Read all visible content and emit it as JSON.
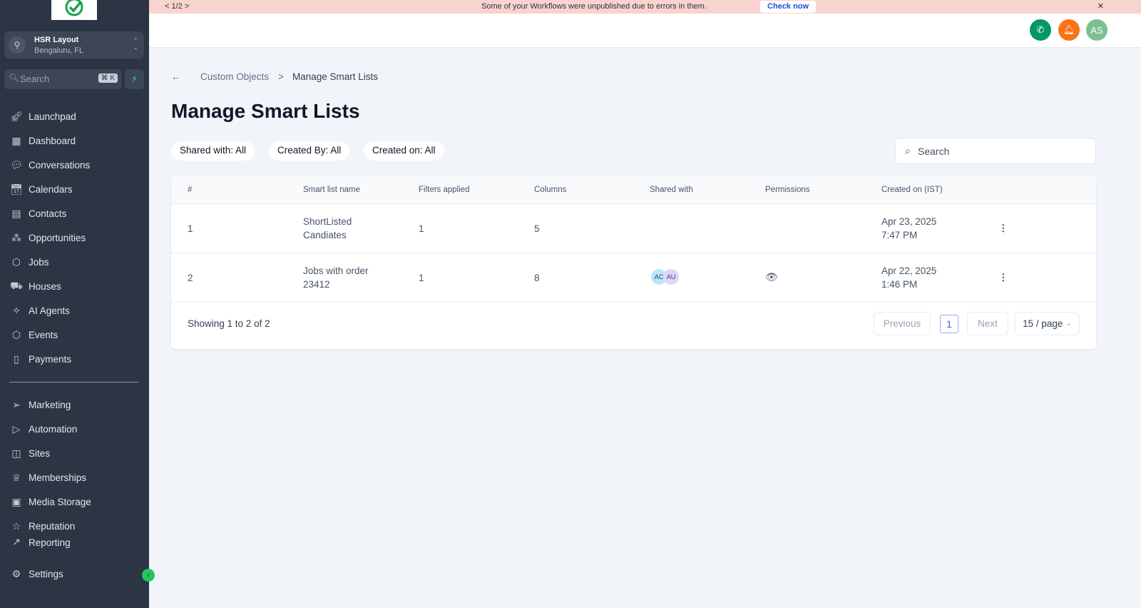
{
  "banner": {
    "pager": "< 1/2 >",
    "message": "Some of your Workflows were unpublished due to errors in them.",
    "action": "Check now",
    "close": "✕"
  },
  "sidebar": {
    "location": {
      "name": "HSR Layout",
      "city": "Bengaluru, FL"
    },
    "search": {
      "placeholder": "Search",
      "shortcut": "⌘ K"
    },
    "items": [
      {
        "label": "Launchpad",
        "icon": "rocket-icon"
      },
      {
        "label": "Dashboard",
        "icon": "grid-icon"
      },
      {
        "label": "Conversations",
        "icon": "chat-icon"
      },
      {
        "label": "Calendars",
        "icon": "calendar-icon"
      },
      {
        "label": "Contacts",
        "icon": "contacts-icon"
      },
      {
        "label": "Opportunities",
        "icon": "network-icon"
      },
      {
        "label": "Jobs",
        "icon": "box-icon"
      },
      {
        "label": "Houses",
        "icon": "car-icon"
      },
      {
        "label": "AI Agents",
        "icon": "sparkle-icon"
      },
      {
        "label": "Events",
        "icon": "box-icon"
      },
      {
        "label": "Payments",
        "icon": "receipt-icon"
      }
    ],
    "items2": [
      {
        "label": "Marketing",
        "icon": "send-icon"
      },
      {
        "label": "Automation",
        "icon": "play-icon"
      },
      {
        "label": "Sites",
        "icon": "globe-icon"
      },
      {
        "label": "Memberships",
        "icon": "award-icon"
      },
      {
        "label": "Media Storage",
        "icon": "image-icon"
      },
      {
        "label": "Reputation",
        "icon": "star-icon"
      },
      {
        "label": "Reporting",
        "icon": "chart-icon"
      }
    ],
    "settings": "Settings"
  },
  "header": {
    "avatar": "AS",
    "colors": {
      "phone": "#059669",
      "bell": "#f97316",
      "avatar": "#7cc08f"
    }
  },
  "breadcrumb": {
    "parent": "Custom Objects",
    "sep": ">",
    "current": "Manage Smart Lists"
  },
  "title": "Manage Smart Lists",
  "filters": [
    "Shared with: All",
    "Created By: All",
    "Created on: All"
  ],
  "search_placeholder": "Search",
  "table": {
    "columns": [
      "#",
      "Smart list name",
      "Filters applied",
      "Columns",
      "Shared with",
      "Permissions",
      "Created on (IST)"
    ],
    "rows": [
      {
        "num": "1",
        "name1": "ShortListed",
        "name2": "Candiates",
        "filters": "1",
        "columns": "5",
        "shared": [],
        "permission": "",
        "date": "Apr 23, 2025",
        "time": "7:47 PM"
      },
      {
        "num": "2",
        "name1": "Jobs with order",
        "name2": "23412",
        "filters": "1",
        "columns": "8",
        "shared": [
          "AC",
          "AU"
        ],
        "permission": "eye-icon",
        "date": "Apr 22, 2025",
        "time": "1:46 PM"
      }
    ]
  },
  "pagination": {
    "summary": "Showing 1 to 2 of 2",
    "previous": "Previous",
    "page": "1",
    "next": "Next",
    "per_page": "15 / page"
  }
}
